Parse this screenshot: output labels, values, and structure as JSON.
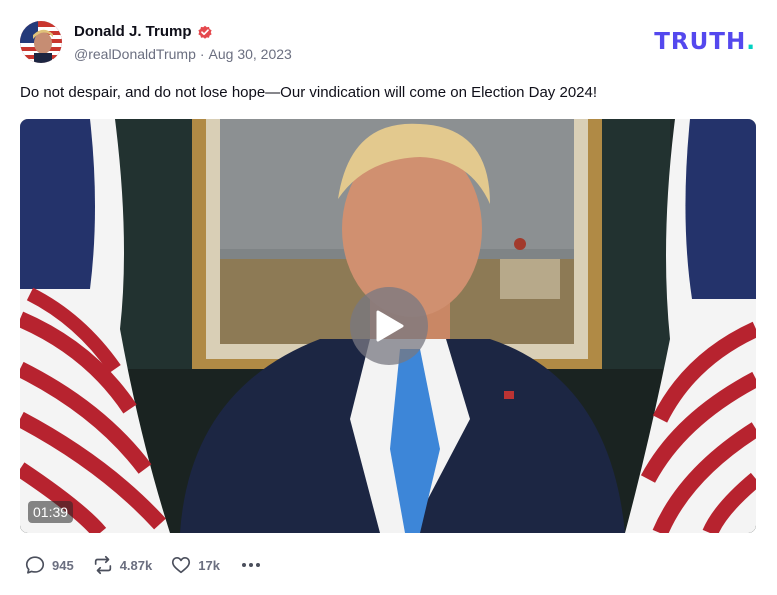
{
  "author": {
    "display_name": "Donald J. Trump",
    "handle": "@realDonaldTrump",
    "separator": "·",
    "date": "Aug 30, 2023",
    "verified": true
  },
  "brand": {
    "name": "TRUTH",
    "dot": "."
  },
  "post": {
    "text": "Do not despair, and do not lose hope—Our vindication will come on Election Day 2024!"
  },
  "video": {
    "duration": "01:39"
  },
  "actions": {
    "replies": "945",
    "retruths": "4.87k",
    "likes": "17k"
  },
  "colors": {
    "brand": "#5448ee",
    "brand_dot": "#00d1c2",
    "verified": "#e5484d",
    "muted_text": "#6b6f80"
  }
}
